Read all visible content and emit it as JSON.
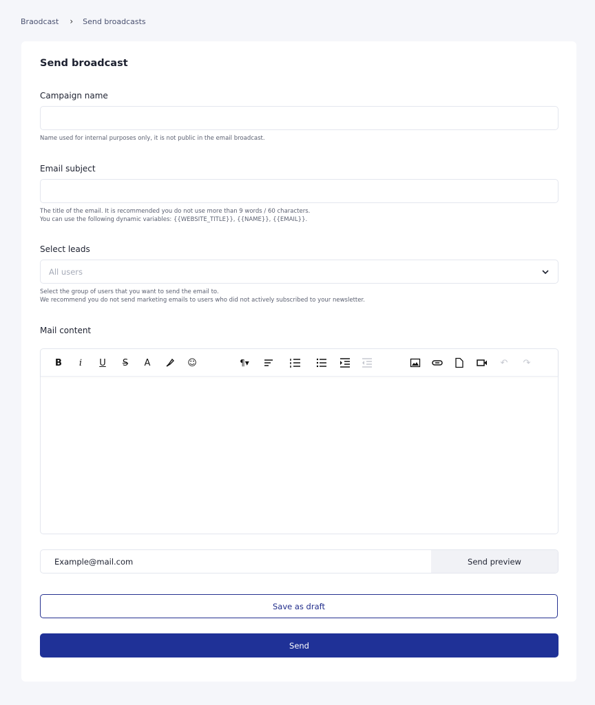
{
  "breadcrumb": {
    "items": [
      "Braodcast",
      "Send broadcasts"
    ]
  },
  "form": {
    "title": "Send broadcast",
    "campaign": {
      "label": "Campaign name",
      "value": "",
      "help": "Name used for internal purposes only, it is not public in the email broadcast."
    },
    "subject": {
      "label": "Email subject",
      "value": "",
      "help1": "The title of the email. It is recommended you do not use more than 9 words / 60 characters.",
      "help2": "You can use the following dynamic variables: {{WEBSITE_TITLE}}, {{NAME}}, {{EMAIL}}."
    },
    "leads": {
      "label": "Select leads",
      "selected": "All users",
      "help1": "Select the group of users that you want to send the email to.",
      "help2": "We recommend you do not send marketing emails to users who did not actively subscribed to your newsletter."
    },
    "content": {
      "label": "Mail content",
      "toolbar": [
        "bold",
        "italic",
        "underline",
        "strikethrough",
        "text-color",
        "highlight",
        "emoji",
        "paragraph-format",
        "align",
        "ordered-list",
        "unordered-list",
        "indent",
        "outdent",
        "insert-image",
        "insert-link",
        "insert-file",
        "insert-video",
        "undo",
        "redo"
      ]
    },
    "preview": {
      "value": "Example@mail.com",
      "button": "Send preview"
    },
    "draft_button": "Save as draft",
    "send_button": "Send"
  },
  "colors": {
    "primary": "#1f3197",
    "background": "#f5f6fa"
  }
}
